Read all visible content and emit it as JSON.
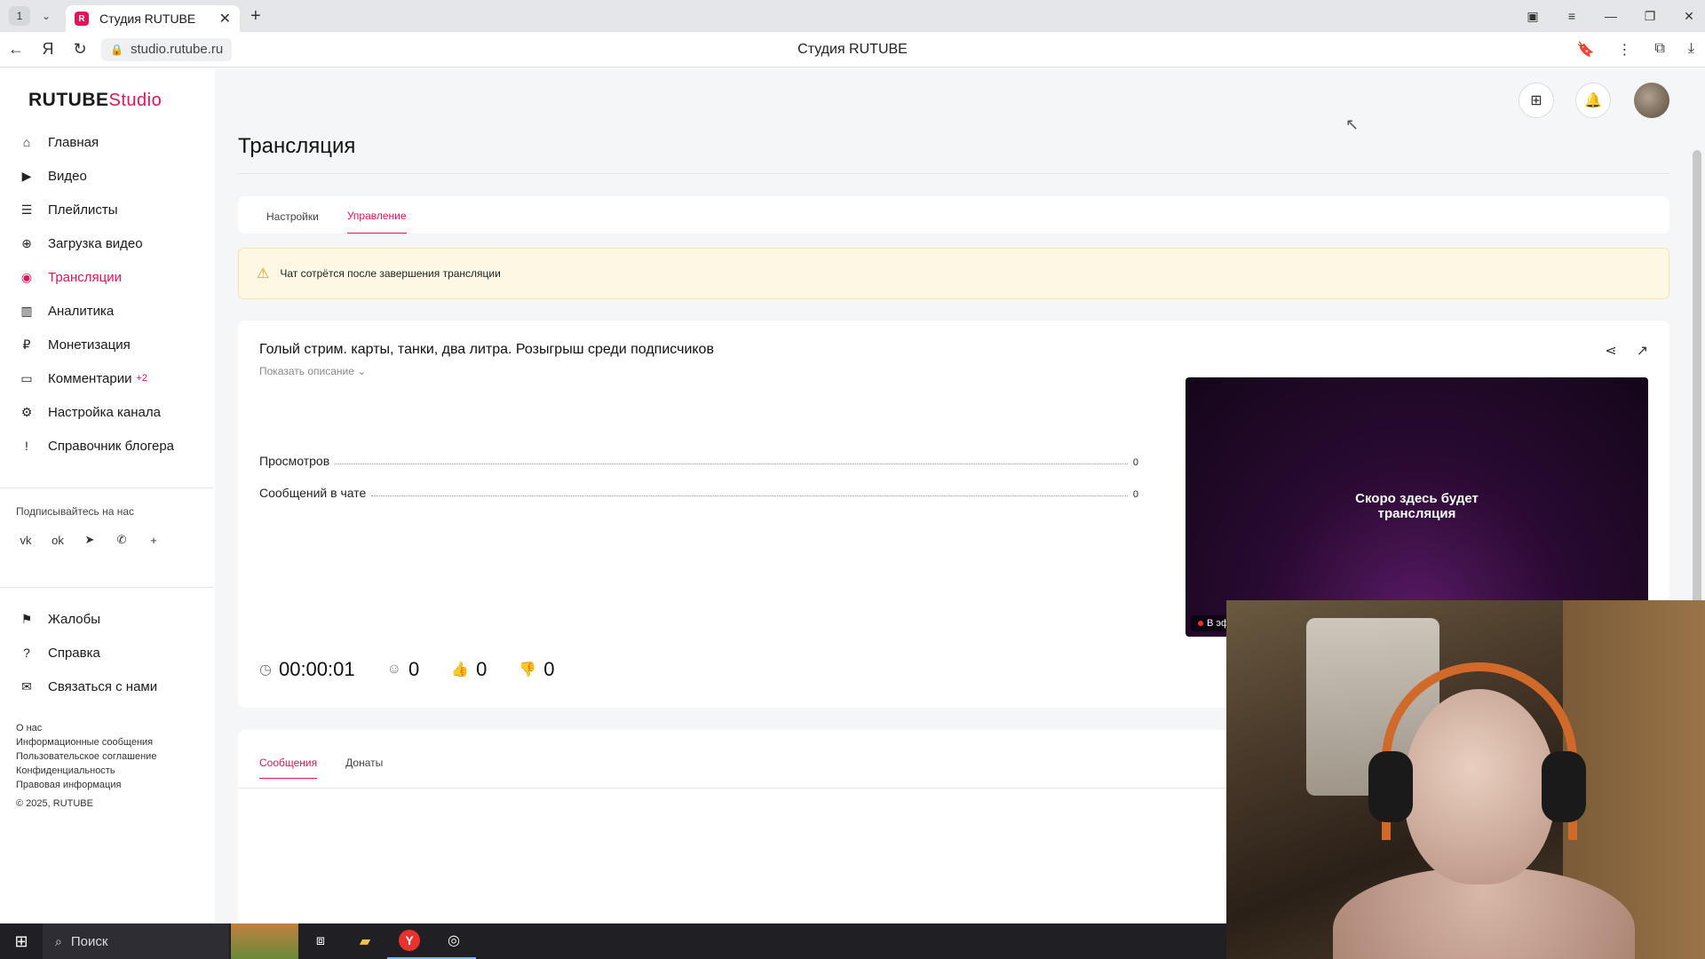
{
  "browser": {
    "tab_counter": "1",
    "tab_title": "Студия RUTUBE",
    "url": "studio.rutube.ru",
    "page_title": "Студия RUTUBE"
  },
  "sidebar": {
    "logo_main": "RUTUBE",
    "logo_studio": "Studio",
    "items": [
      {
        "label": "Главная",
        "icon": "home-icon",
        "glyph": "⌂"
      },
      {
        "label": "Видео",
        "icon": "video-icon",
        "glyph": "▶"
      },
      {
        "label": "Плейлисты",
        "icon": "playlist-icon",
        "glyph": "☰"
      },
      {
        "label": "Загрузка видео",
        "icon": "upload-icon",
        "glyph": "⊕"
      },
      {
        "label": "Трансляции",
        "icon": "broadcast-icon",
        "glyph": "◉"
      },
      {
        "label": "Аналитика",
        "icon": "analytics-icon",
        "glyph": "▥"
      },
      {
        "label": "Монетизация",
        "icon": "ruble-icon",
        "glyph": "₽"
      },
      {
        "label": "Комментарии",
        "icon": "comments-icon",
        "glyph": "▭",
        "badge": "+2"
      },
      {
        "label": "Настройка канала",
        "icon": "settings-icon",
        "glyph": "⚙"
      },
      {
        "label": "Справочник блогера",
        "icon": "handbook-icon",
        "glyph": "!"
      }
    ],
    "follow_title": "Подписывайтесь на нас",
    "socials": [
      {
        "name": "vk-icon",
        "glyph": "vk"
      },
      {
        "name": "odnoklassniki-icon",
        "glyph": "ok"
      },
      {
        "name": "telegram-icon",
        "glyph": "➤"
      },
      {
        "name": "viber-icon",
        "glyph": "✆"
      },
      {
        "name": "plus-icon",
        "glyph": "+"
      }
    ],
    "bottom_items": [
      {
        "label": "Жалобы",
        "icon": "flag-icon",
        "glyph": "⚑"
      },
      {
        "label": "Справка",
        "icon": "help-icon",
        "glyph": "?"
      },
      {
        "label": "Связаться с нами",
        "icon": "mail-icon",
        "glyph": "✉"
      }
    ],
    "footer_links": [
      "О нас",
      "Информационные сообщения",
      "Пользовательское соглашение",
      "Конфиденциальность",
      "Правовая информация"
    ],
    "copyright": "© 2025, RUTUBE"
  },
  "main": {
    "title": "Трансляция",
    "tabs": [
      {
        "label": "Настройки",
        "active": false
      },
      {
        "label": "Управление",
        "active": true
      }
    ],
    "alert_text": "Чат сотрётся после завершения трансляции",
    "stream": {
      "title": "Голый стрим. карты, танки, два литра. Розыгрыш среди подписчиков",
      "show_description": "Показать описание",
      "stats": [
        {
          "label": "Просмотров",
          "value": "0"
        },
        {
          "label": "Сообщений в чате",
          "value": "0"
        }
      ],
      "player_text_line1": "Скоро здесь будет",
      "player_text_line2": "трансляция",
      "live_label": "В эф",
      "duration": "00:00:01",
      "viewers": "0",
      "likes": "0",
      "dislikes": "0"
    },
    "chat_tabs": [
      {
        "label": "Сообщения",
        "active": true
      },
      {
        "label": "Донаты",
        "active": false
      }
    ]
  },
  "taskbar": {
    "search_label": "Поиск"
  },
  "colors": {
    "accent": "#e0145a",
    "alert_bg": "#fdf8e4"
  }
}
